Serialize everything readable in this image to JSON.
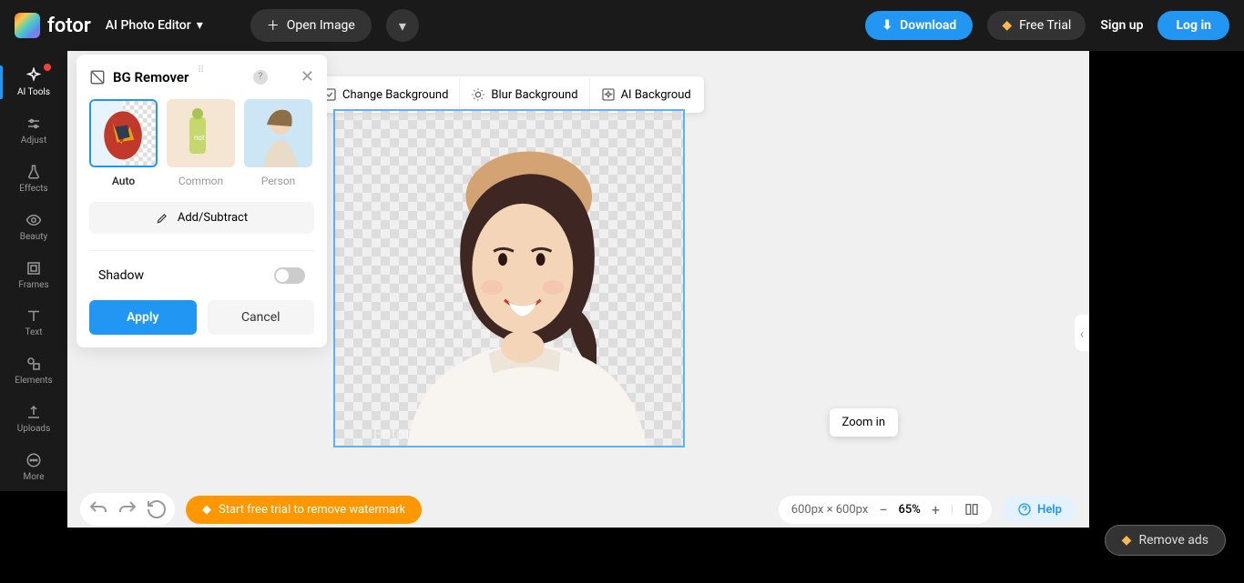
{
  "header": {
    "brand": "fotor",
    "editor_dropdown": "AI Photo Editor",
    "open_image": "Open Image",
    "download": "Download",
    "free_trial": "Free Trial",
    "sign_up": "Sign up",
    "log_in": "Log in"
  },
  "sidebar": {
    "items": [
      {
        "label": "AI Tools"
      },
      {
        "label": "Adjust"
      },
      {
        "label": "Effects"
      },
      {
        "label": "Beauty"
      },
      {
        "label": "Frames"
      },
      {
        "label": "Text"
      },
      {
        "label": "Elements"
      },
      {
        "label": "Uploads"
      },
      {
        "label": "More"
      }
    ]
  },
  "panel": {
    "title": "BG Remover",
    "tabs": [
      {
        "label": "Auto"
      },
      {
        "label": "Common"
      },
      {
        "label": "Person"
      }
    ],
    "add_subtract": "Add/Subtract",
    "shadow_label": "Shadow",
    "apply": "Apply",
    "cancel": "Cancel"
  },
  "bg_toolbar": {
    "change_bg": "Change Background",
    "blur_bg": "Blur Background",
    "ai_bg": "AI Backgroud"
  },
  "tooltip": {
    "zoom_in": "Zoom in"
  },
  "bottombar": {
    "trial_text": "Start free trial to remove watermark",
    "dimensions": "600px × 600px",
    "zoom_pct": "65%",
    "help": "Help"
  },
  "remove_ads": "Remove ads"
}
